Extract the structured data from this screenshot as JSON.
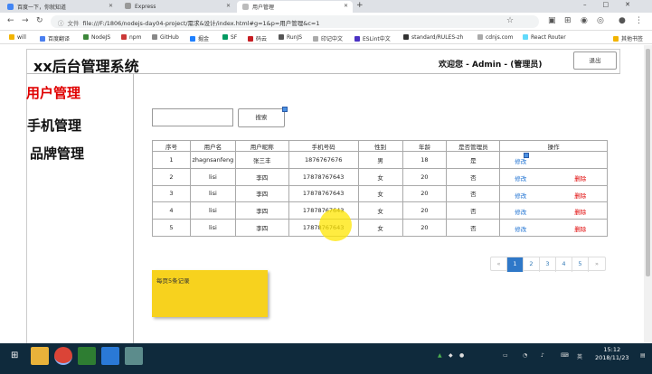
{
  "browser": {
    "tabs": [
      {
        "label": "百度一下，你就知道",
        "active": false
      },
      {
        "label": "Express",
        "active": false
      },
      {
        "label": "用户管理",
        "active": true
      }
    ],
    "new_tab": "+",
    "url_scheme": "文件",
    "url": "file:///F:/1806/nodejs-day04-project/需求&设计/index.html#g=1&p=用户管理&c=1",
    "bookmarks": [
      "will",
      "百度翻译",
      "NodeJS",
      "npm",
      "GitHub",
      "掘金",
      "SF",
      "码云",
      "RunJS",
      "印记中文",
      "ESLint中文",
      "standard/RULES-zh",
      "cdnjs.com",
      "React Router",
      "其他书签"
    ]
  },
  "header": {
    "brand": "xx后台管理系统",
    "welcome": "欢迎您 - Admin - (管理员)",
    "logout_label": "退出"
  },
  "sidebar": {
    "items": [
      {
        "label": "用户管理",
        "active": true
      },
      {
        "label": "手机管理",
        "active": false
      },
      {
        "label": "品牌管理",
        "active": false
      }
    ]
  },
  "search": {
    "placeholder": "",
    "button_label": "搜索"
  },
  "table": {
    "headers": [
      "序号",
      "用户名",
      "用户昵称",
      "手机号码",
      "性别",
      "年龄",
      "是否管理员",
      "操作"
    ],
    "rows": [
      {
        "id": "1",
        "username": "zhagnsanfeng",
        "nickname": "张三丰",
        "phone": "1876767676",
        "gender": "男",
        "age": "18",
        "admin": "是",
        "edit": "修改",
        "delete": ""
      },
      {
        "id": "2",
        "username": "lisi",
        "nickname": "李四",
        "phone": "17878767643",
        "gender": "女",
        "age": "20",
        "admin": "否",
        "edit": "修改",
        "delete": "删除"
      },
      {
        "id": "3",
        "username": "lisi",
        "nickname": "李四",
        "phone": "17878767643",
        "gender": "女",
        "age": "20",
        "admin": "否",
        "edit": "修改",
        "delete": "删除"
      },
      {
        "id": "4",
        "username": "lisi",
        "nickname": "李四",
        "phone": "17878767643",
        "gender": "女",
        "age": "20",
        "admin": "否",
        "edit": "修改",
        "delete": "删除"
      },
      {
        "id": "5",
        "username": "lisi",
        "nickname": "李四",
        "phone": "17878767643",
        "gender": "女",
        "age": "20",
        "admin": "否",
        "edit": "修改",
        "delete": "删除"
      }
    ]
  },
  "pagination": {
    "prev": "«",
    "pages": [
      "1",
      "2",
      "3",
      "4",
      "5"
    ],
    "current": "1",
    "next": "»"
  },
  "note": {
    "text": "每页5条记录"
  },
  "taskbar": {
    "ime": "英",
    "time": "15:12",
    "date": "2018/11/23"
  },
  "colors": {
    "accent_red": "#e00000",
    "link_blue": "#1a6fd1",
    "pager_active": "#2f78c8",
    "note_yellow": "#f7d21e",
    "taskbar": "#0f2a3c"
  }
}
